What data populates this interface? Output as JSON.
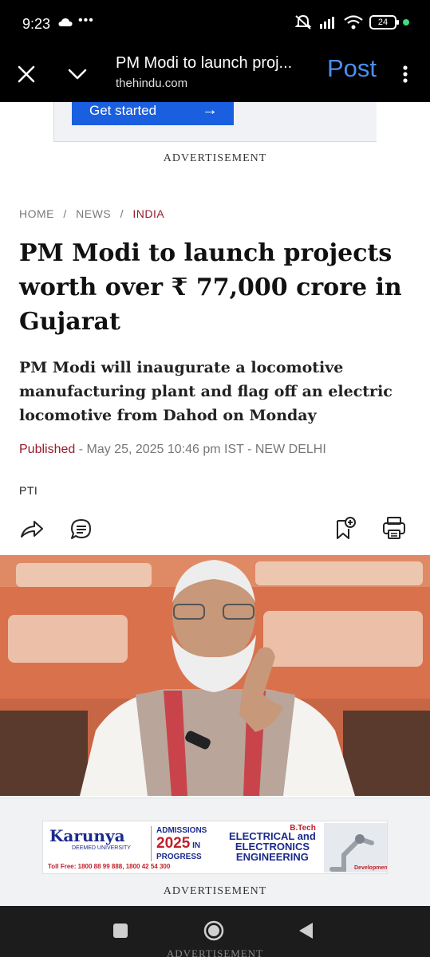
{
  "status_bar": {
    "time": "9:23",
    "dots": "•••",
    "battery": "24"
  },
  "browser": {
    "tab_title": "PM Modi to launch proj...",
    "domain": "thehindu.com",
    "post_label": "Post",
    "accent_color": "#4a8ff0"
  },
  "ad_top": {
    "cta_label": "Get started",
    "cta_arrow": "→",
    "label": "ADVERTISEMENT"
  },
  "breadcrumb": {
    "items": [
      "HOME",
      "NEWS",
      "INDIA"
    ],
    "separator": "/"
  },
  "article": {
    "headline": "PM Modi to launch projects worth over ₹ 77,000 crore in Gujarat",
    "subheadline": "PM Modi will inaugurate a locomotive manufacturing plant and flag off an electric locomotive from Dahod on Monday",
    "published_label": "Published",
    "published_rest": " - May 25, 2025 10:46 pm IST - NEW DELHI",
    "author": "PTI",
    "brand_color": "#9a1a2b"
  },
  "actions": {
    "icons": [
      "share-icon",
      "comment-icon",
      "bookmark-add-icon",
      "print-icon"
    ]
  },
  "ad_bottom": {
    "brand": "Karunya",
    "brand_sub": "DEEMED UNIVERSITY",
    "admissions": "ADMISSIONS",
    "year": "2025",
    "year_suffix": "IN",
    "progress": "PROGRESS",
    "btech": "B.Tech",
    "program_line1": "ELECTRICAL and",
    "program_line2": "ELECTRONICS",
    "program_line3": "ENGINEERING",
    "toll": "Toll Free: 1800 88 99 888, 1800 42 54 300",
    "label": "ADVERTISEMENT",
    "peek_label": "ADVERTISEMENT"
  },
  "nav": {
    "icons": [
      "recents-square-icon",
      "home-circle-icon",
      "back-triangle-icon"
    ]
  }
}
